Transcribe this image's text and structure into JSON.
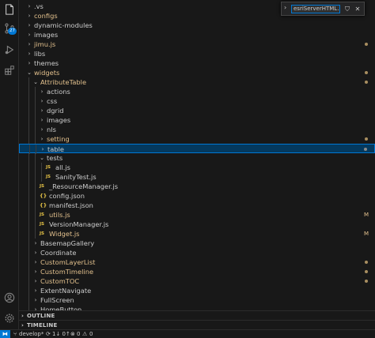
{
  "activity_bar": {
    "icons": [
      "explorer-icon",
      "search-icon",
      "source-control-icon",
      "run-debug-icon",
      "extensions-icon",
      "account-icon",
      "manage-gear-icon"
    ],
    "scm_badge": "27"
  },
  "find_widget": {
    "value": "esriServerHTML...",
    "toggle_icon": "chevron-right-icon",
    "filter_icon": "filter-icon",
    "close_icon": "close-icon"
  },
  "tree": {
    "items": [
      {
        "label": ".vs",
        "kind": "folder",
        "expanded": false,
        "depth": 0,
        "modified": false,
        "status": "none"
      },
      {
        "label": "configs",
        "kind": "folder",
        "expanded": false,
        "depth": 0,
        "modified": true,
        "status": "none"
      },
      {
        "label": "dynamic-modules",
        "kind": "folder",
        "expanded": false,
        "depth": 0,
        "modified": false,
        "status": "none"
      },
      {
        "label": "images",
        "kind": "folder",
        "expanded": false,
        "depth": 0,
        "modified": false,
        "status": "none"
      },
      {
        "label": "jimu.js",
        "kind": "folder",
        "expanded": false,
        "depth": 0,
        "modified": true,
        "status": "dot"
      },
      {
        "label": "libs",
        "kind": "folder",
        "expanded": false,
        "depth": 0,
        "modified": false,
        "status": "none"
      },
      {
        "label": "themes",
        "kind": "folder",
        "expanded": false,
        "depth": 0,
        "modified": false,
        "status": "none"
      },
      {
        "label": "widgets",
        "kind": "folder",
        "expanded": true,
        "depth": 0,
        "modified": true,
        "status": "dot"
      },
      {
        "label": "AttributeTable",
        "kind": "folder",
        "expanded": true,
        "depth": 1,
        "modified": true,
        "status": "dot"
      },
      {
        "label": "actions",
        "kind": "folder",
        "expanded": false,
        "depth": 2,
        "modified": false,
        "status": "none"
      },
      {
        "label": "css",
        "kind": "folder",
        "expanded": false,
        "depth": 2,
        "modified": false,
        "status": "none"
      },
      {
        "label": "dgrid",
        "kind": "folder",
        "expanded": false,
        "depth": 2,
        "modified": false,
        "status": "none"
      },
      {
        "label": "images",
        "kind": "folder",
        "expanded": false,
        "depth": 2,
        "modified": false,
        "status": "none"
      },
      {
        "label": "nls",
        "kind": "folder",
        "expanded": false,
        "depth": 2,
        "modified": false,
        "status": "none"
      },
      {
        "label": "setting",
        "kind": "folder",
        "expanded": false,
        "depth": 2,
        "modified": true,
        "status": "dot"
      },
      {
        "label": "table",
        "kind": "folder",
        "expanded": false,
        "depth": 2,
        "modified": false,
        "status": "dot",
        "selected": true
      },
      {
        "label": "tests",
        "kind": "folder",
        "expanded": true,
        "depth": 2,
        "modified": false,
        "status": "none"
      },
      {
        "label": "all.js",
        "kind": "js",
        "depth": 3,
        "modified": false,
        "status": "none"
      },
      {
        "label": "SanityTest.js",
        "kind": "js",
        "depth": 3,
        "modified": false,
        "status": "none"
      },
      {
        "label": "_ResourceManager.js",
        "kind": "js",
        "depth": 2,
        "modified": false,
        "status": "none"
      },
      {
        "label": "config.json",
        "kind": "json",
        "depth": 2,
        "modified": false,
        "status": "none"
      },
      {
        "label": "manifest.json",
        "kind": "json",
        "depth": 2,
        "modified": false,
        "status": "none"
      },
      {
        "label": "utils.js",
        "kind": "js",
        "depth": 2,
        "modified": true,
        "status": "M"
      },
      {
        "label": "VersionManager.js",
        "kind": "js",
        "depth": 2,
        "modified": false,
        "status": "none"
      },
      {
        "label": "Widget.js",
        "kind": "js",
        "depth": 2,
        "modified": true,
        "status": "M"
      },
      {
        "label": "BasemapGallery",
        "kind": "folder",
        "expanded": false,
        "depth": 1,
        "modified": false,
        "status": "none"
      },
      {
        "label": "Coordinate",
        "kind": "folder",
        "expanded": false,
        "depth": 1,
        "modified": false,
        "status": "none"
      },
      {
        "label": "CustomLayerList",
        "kind": "folder",
        "expanded": false,
        "depth": 1,
        "modified": true,
        "status": "dot"
      },
      {
        "label": "CustomTimeline",
        "kind": "folder",
        "expanded": false,
        "depth": 1,
        "modified": true,
        "status": "dot"
      },
      {
        "label": "CustomTOC",
        "kind": "folder",
        "expanded": false,
        "depth": 1,
        "modified": true,
        "status": "dot"
      },
      {
        "label": "ExtentNavigate",
        "kind": "folder",
        "expanded": false,
        "depth": 1,
        "modified": false,
        "status": "none"
      },
      {
        "label": "FullScreen",
        "kind": "folder",
        "expanded": false,
        "depth": 1,
        "modified": false,
        "status": "none"
      },
      {
        "label": "HomeButton",
        "kind": "folder",
        "expanded": false,
        "depth": 1,
        "modified": false,
        "status": "none"
      }
    ]
  },
  "panels": {
    "outline": "OUTLINE",
    "timeline": "TIMELINE"
  },
  "status_bar": {
    "remote_icon": "remote-icon",
    "branch": "develop*",
    "sync": "1↓ 0↑",
    "errors": "0",
    "warnings": "0"
  },
  "colors": {
    "accent": "#0078d4",
    "modified": "#e2c08d",
    "js_icon": "#e8c547",
    "selection": "#04395e"
  }
}
